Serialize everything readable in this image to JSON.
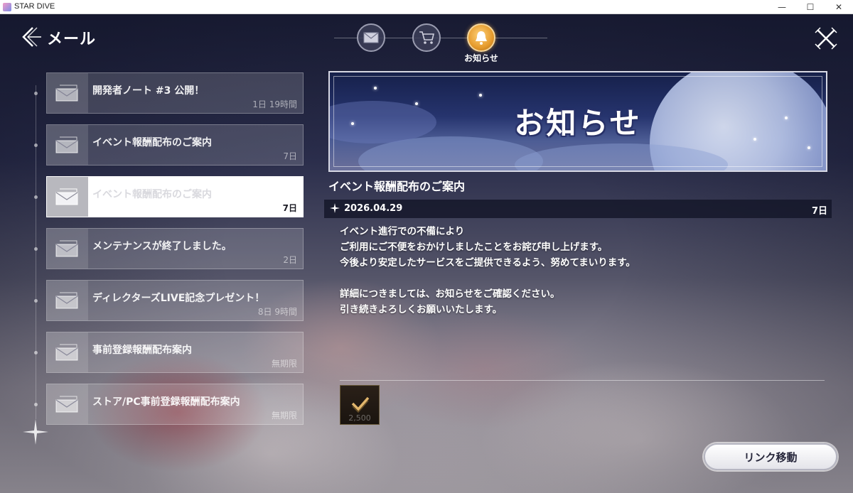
{
  "window": {
    "title": "STAR DIVE",
    "minimize_glyph": "—",
    "maximize_glyph": "☐",
    "close_glyph": "✕"
  },
  "header": {
    "title": "メール",
    "back_icon": "back-arrow-icon",
    "close_icon": "crossed-swords-close-icon"
  },
  "tabs": [
    {
      "icon": "envelope-icon",
      "active": false
    },
    {
      "icon": "cart-icon",
      "active": false
    },
    {
      "icon": "bell-icon",
      "active": true,
      "label": "お知らせ"
    }
  ],
  "mail_list": [
    {
      "title": "開発者ノート #3 公開！",
      "time": "1日 19時間"
    },
    {
      "title": "イベント報酬配布のご案内",
      "time": "7日"
    },
    {
      "title": "イベント報酬配布のご案内",
      "time": "7日",
      "selected": true
    },
    {
      "title": "メンテナンスが終了しました。",
      "time": "2日"
    },
    {
      "title": "ディレクターズLIVE記念プレゼント！",
      "time": "8日 9時間"
    },
    {
      "title": "事前登録報酬配布案内",
      "time": "無期限"
    },
    {
      "title": "ストア/PC事前登録報酬配布案内",
      "time": "無期限"
    }
  ],
  "detail": {
    "banner_text": "お知らせ",
    "title": "イベント報酬配布のご案内",
    "date": "2026.04.29",
    "days": "7日",
    "body_lines": [
      "イベント進行での不備により",
      "ご利用にご不便をおかけしましたことをお詫び申し上げます。",
      "今後より安定したサービスをご提供できるよう、努めてまいります。",
      "",
      "詳細につきましては、お知らせをご確認ください。",
      "引き続きよろしくお願いいたします。"
    ],
    "reward": {
      "icon": "checkmark-ticket-icon",
      "quantity": "2,500"
    },
    "link_button": "リンク移動"
  },
  "colors": {
    "accent_gold": "#e59a2c",
    "selected_bg": "#ffffff"
  }
}
